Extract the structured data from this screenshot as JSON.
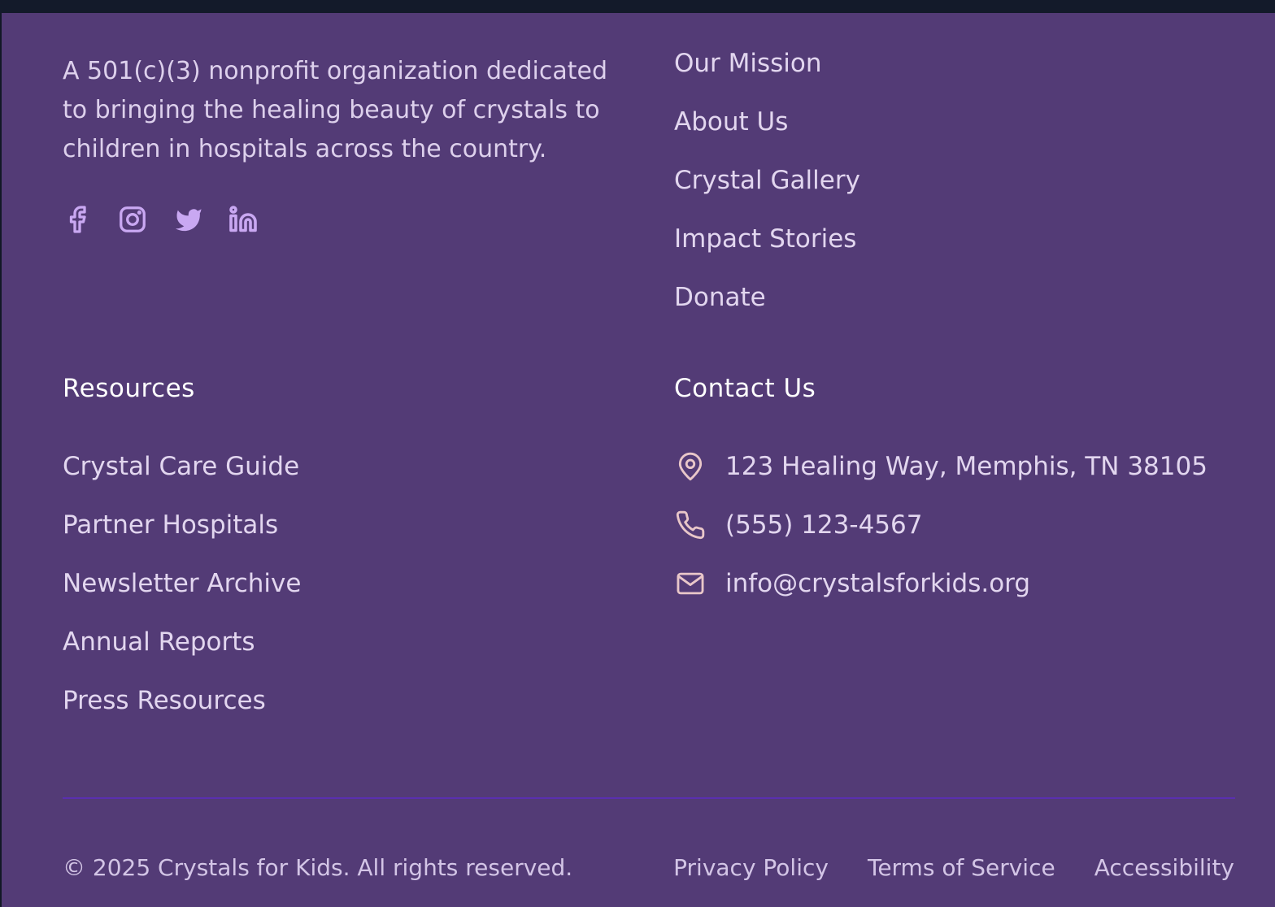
{
  "colors": {
    "footer_background": "#533b76",
    "top_bar_background": "#131a2a",
    "social_icon": "#c9a8f2",
    "contact_icon": "#e9c7c9",
    "divider": "#5a2fb0",
    "heading": "#ffffff"
  },
  "about": {
    "description": "A 501(c)(3) nonprofit organization dedicated to bringing the healing beauty of crystals to children in hospitals across the country."
  },
  "socials": [
    {
      "icon": "facebook-icon"
    },
    {
      "icon": "instagram-icon"
    },
    {
      "icon": "twitter-icon"
    },
    {
      "icon": "linkedin-icon"
    }
  ],
  "quick_links": [
    {
      "label": "Our Mission"
    },
    {
      "label": "About Us"
    },
    {
      "label": "Crystal Gallery"
    },
    {
      "label": "Impact Stories"
    },
    {
      "label": "Donate"
    }
  ],
  "resources": {
    "heading": "Resources",
    "items": [
      {
        "label": "Crystal Care Guide"
      },
      {
        "label": "Partner Hospitals"
      },
      {
        "label": "Newsletter Archive"
      },
      {
        "label": "Annual Reports"
      },
      {
        "label": "Press Resources"
      }
    ]
  },
  "contact": {
    "heading": "Contact Us",
    "items": [
      {
        "icon": "map-pin-icon",
        "text": "123 Healing Way, Memphis, TN 38105"
      },
      {
        "icon": "phone-icon",
        "text": "(555) 123-4567"
      },
      {
        "icon": "mail-icon",
        "text": "info@crystalsforkids.org"
      }
    ]
  },
  "bottom": {
    "copyright": "© 2025 Crystals for Kids. All rights reserved.",
    "legal_links": [
      {
        "label": "Privacy Policy"
      },
      {
        "label": "Terms of Service"
      },
      {
        "label": "Accessibility"
      }
    ]
  }
}
